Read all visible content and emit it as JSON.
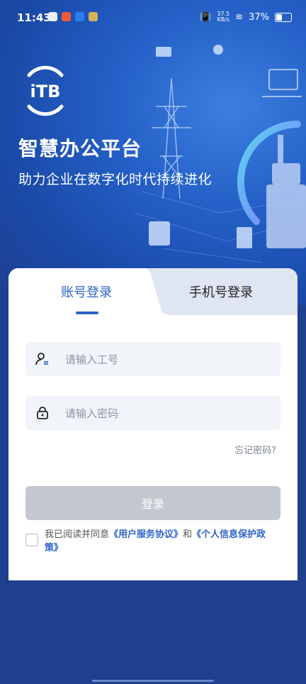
{
  "status": {
    "time": "11:43",
    "netspeed_value": "37.5",
    "netspeed_unit": "KB/s",
    "battery": "37%",
    "battery_level": 0.37
  },
  "brand": {
    "logo_text": "iTB",
    "title": "智慧办公平台",
    "subtitle": "助力企业在数字化时代持续进化"
  },
  "tabs": {
    "account": "账号登录",
    "phone": "手机号登录"
  },
  "form": {
    "user_placeholder": "请输入工号",
    "password_placeholder": "请输入密码",
    "forgot": "忘记密码?",
    "login": "登录"
  },
  "agreement": {
    "prefix": "我已阅读并同意",
    "service": "《用户服务协议》",
    "and": "和",
    "privacy": "《个人信息保护政策》"
  },
  "colors": {
    "primary": "#2f63c9",
    "hero": "#2561c8",
    "disabled_button": "#c3c8d0"
  }
}
